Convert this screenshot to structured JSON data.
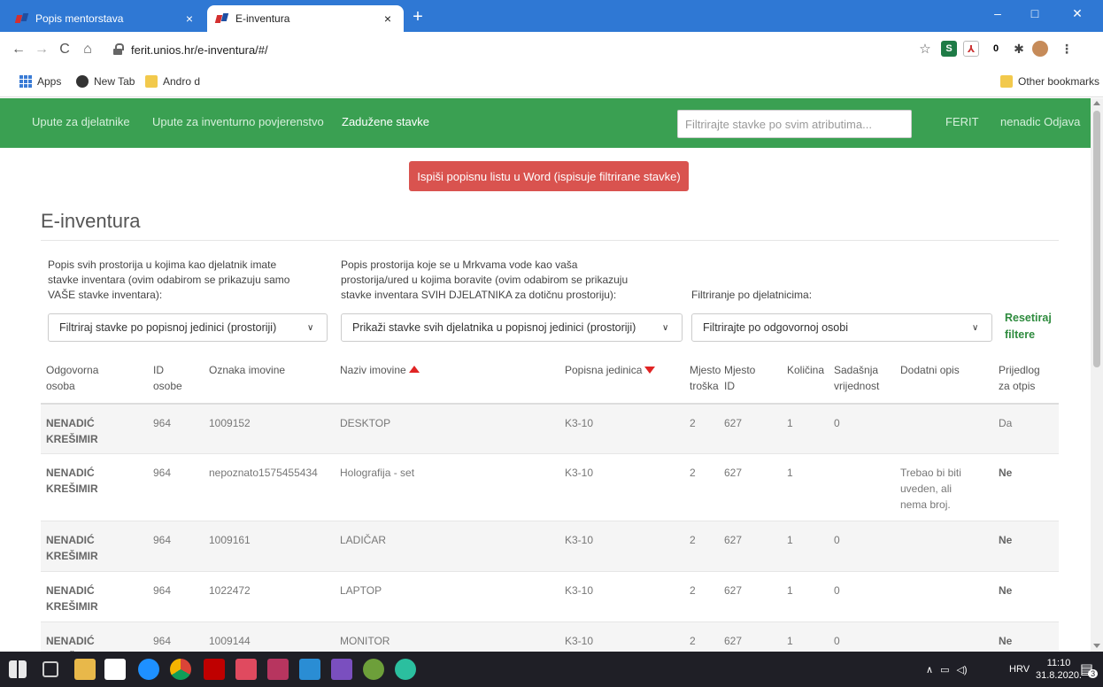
{
  "browser": {
    "tabs": [
      {
        "title": "Popis mentorstava",
        "close": "×"
      },
      {
        "title": "E-inventura",
        "close": "×"
      }
    ],
    "new_tab": "+",
    "window_controls": {
      "minimize": "–",
      "maximize": "□",
      "close": "✕"
    },
    "url": "ferit.unios.hr/e-inventura/#/",
    "bookmarks": [
      "Apps",
      "New Tab",
      "Andro d"
    ],
    "other_bookmarks": "Other bookmarks",
    "extension_badge": "0"
  },
  "navbar": {
    "links": [
      "Upute za djelatnike",
      "Upute za inventurno povjerenstvo",
      "Zadužene stavke"
    ],
    "active_index": 2,
    "filter_placeholder": "Filtrirajte stavke po svim atributima...",
    "brand": "FERIT",
    "user": "nenadic Odjava"
  },
  "content": {
    "print_button": "Ispiši popisnu listu u Word (ispisuje filtrirane stavke)",
    "title": "E-inventura",
    "filters": {
      "rooms_label": [
        "Popis svih prostorija u kojima kao djelatnik imate",
        "stavke inventara (ovim odabirom se prikazuju samo",
        "VAŠE stavke inventara):"
      ],
      "rooms_select": "Filtriraj stavke po popisnoj jedinici (prostoriji)",
      "mrkve_label": [
        "Popis prostorija koje se u Mrkvama vode kao vaša",
        "prostorija/ured u kojima boravite (ovim odabirom se prikazuju",
        "stavke inventara SVIH DJELATNIKA za dotičnu prostoriju):"
      ],
      "mrkve_select": "Prikaži stavke svih djelatnika u popisnoj jedinici (prostoriji)",
      "employee_label": "Filtriranje po djelatnicima:",
      "employee_select": "Filtrirajte po odgovornoj osobi",
      "reset": [
        "Resetiraj",
        "filtere"
      ]
    },
    "table": {
      "headers": [
        [
          "Odgovorna",
          "osoba"
        ],
        [
          "ID",
          "osobe"
        ],
        [
          "",
          "Oznaka imovine"
        ],
        [
          "",
          "Naziv imovine"
        ],
        [
          "",
          "Popisna jedinica"
        ],
        [
          "Mjesto",
          "troška"
        ],
        [
          "Mjesto",
          "ID"
        ],
        [
          "",
          "Količina"
        ],
        [
          "Sadašnja",
          "vrijednost"
        ],
        [
          "",
          "Dodatni opis"
        ],
        [
          "Prijedlog",
          "za otpis"
        ]
      ],
      "rows": [
        {
          "osoba": [
            "NENADIĆ",
            "KREŠIMIR"
          ],
          "id": "964",
          "oznaka": "1009152",
          "naziv": "DESKTOP",
          "jedinica": "K3-10",
          "trosak": "2",
          "mjesto_id": "627",
          "kolicina": "1",
          "vrijednost": "0",
          "opis": [],
          "otpis": "Da"
        },
        {
          "osoba": [
            "NENADIĆ",
            "KREŠIMIR"
          ],
          "id": "964",
          "oznaka": "nepoznato1575455434",
          "naziv": "Holografija - set",
          "jedinica": "K3-10",
          "trosak": "2",
          "mjesto_id": "627",
          "kolicina": "1",
          "vrijednost": "",
          "opis": [
            "Trebao bi biti",
            "uveden, ali",
            "nema broj."
          ],
          "otpis": "Ne"
        },
        {
          "osoba": [
            "NENADIĆ",
            "KREŠIMIR"
          ],
          "id": "964",
          "oznaka": "1009161",
          "naziv": "LADIČAR",
          "jedinica": "K3-10",
          "trosak": "2",
          "mjesto_id": "627",
          "kolicina": "1",
          "vrijednost": "0",
          "opis": [],
          "otpis": "Ne"
        },
        {
          "osoba": [
            "NENADIĆ",
            "KREŠIMIR"
          ],
          "id": "964",
          "oznaka": "1022472",
          "naziv": "LAPTOP",
          "jedinica": "K3-10",
          "trosak": "2",
          "mjesto_id": "627",
          "kolicina": "1",
          "vrijednost": "0",
          "opis": [],
          "otpis": "Ne"
        },
        {
          "osoba": [
            "NENADIĆ",
            "KREŠIMIR"
          ],
          "id": "964",
          "oznaka": "1009144",
          "naziv": "MONITOR",
          "jedinica": "K3-10",
          "trosak": "2",
          "mjesto_id": "627",
          "kolicina": "1",
          "vrijednost": "0",
          "opis": [],
          "otpis": "Ne"
        }
      ]
    }
  },
  "taskbar": {
    "tray_lang": "HRV",
    "time": "11:10",
    "date": "31.8.2020.",
    "notification_count": "3"
  },
  "colors": {
    "tab_strip": "#2f78d4",
    "navbar": "#3aa052",
    "print_button": "#d9534f",
    "sort_arrow": "#e02424",
    "reset_link": "#2e8b3e"
  }
}
